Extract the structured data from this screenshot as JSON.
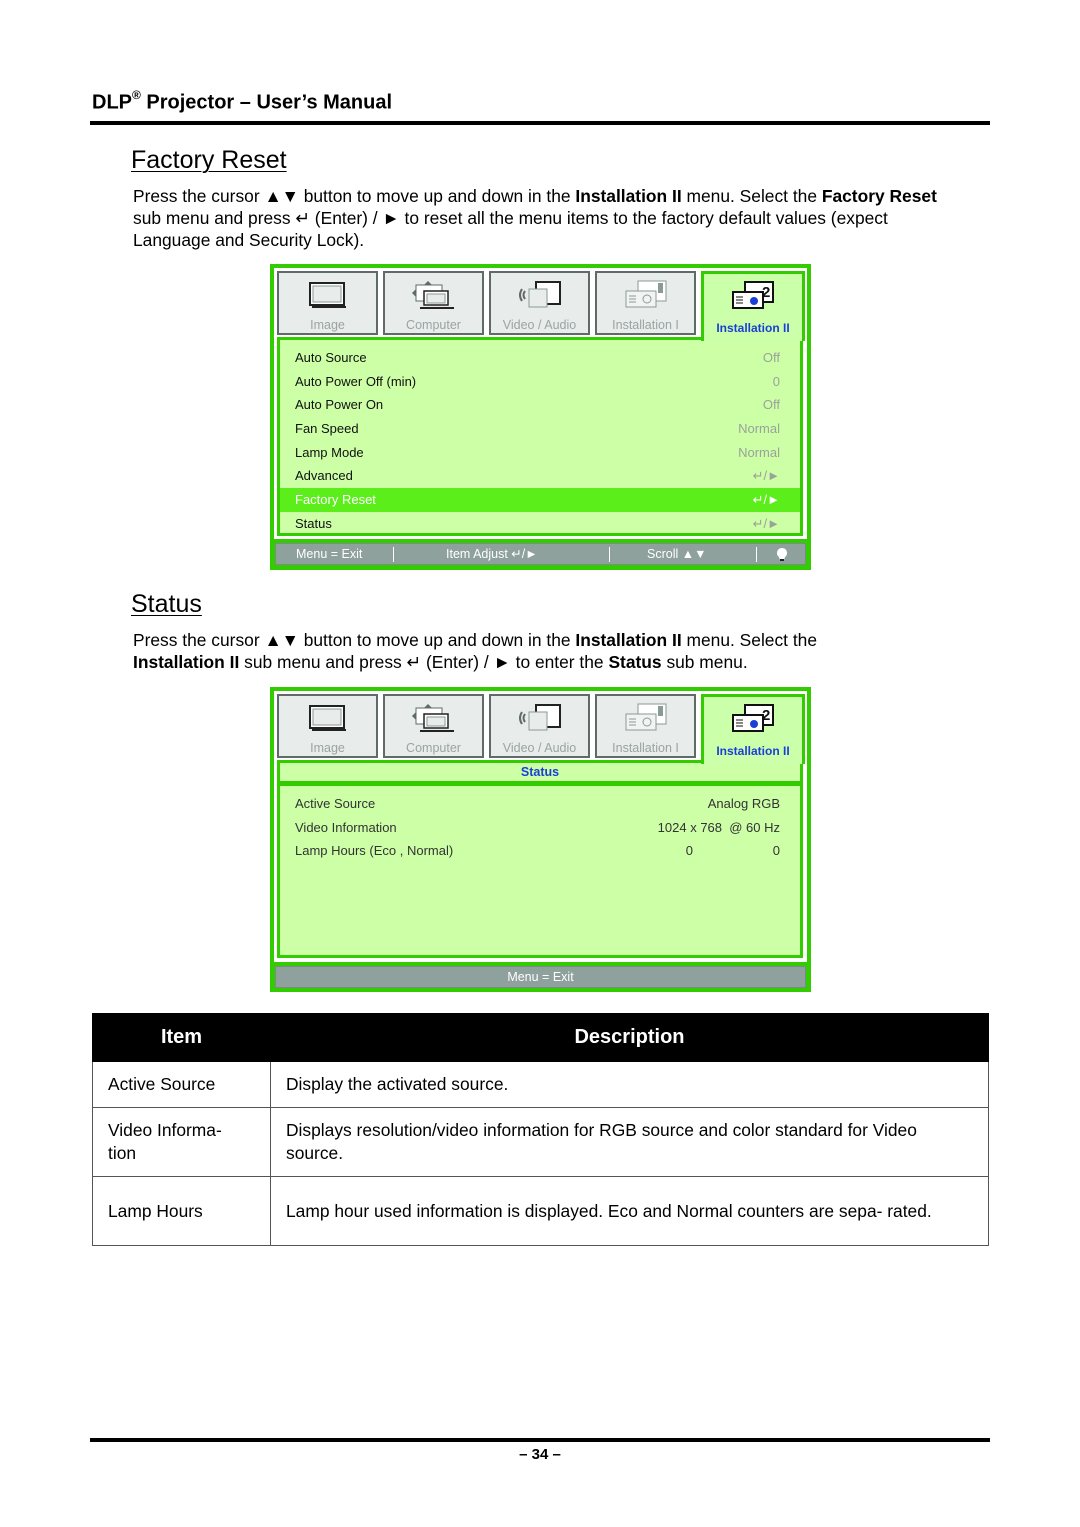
{
  "header": {
    "title_prefix": "DLP",
    "registered_mark": "®",
    "title_suffix": " Projector – User’s Manual"
  },
  "sections": {
    "factory_reset": {
      "title": "Factory Reset",
      "paragraph": {
        "t1": "Press the cursor ▲▼ button to move up and down in the ",
        "b1": "Installation II",
        "t2": " menu. Select the ",
        "b2": "Factory Reset",
        "t3": " sub menu and press ↵ (Enter) / ► to reset all the menu items to the factory default values (expect Language and Security Lock)."
      }
    },
    "status": {
      "title": "Status",
      "paragraph": {
        "t1": "Press the cursor ▲▼ button to move up and down in the ",
        "b1": "Installation II",
        "t2": " menu. Select the ",
        "b2": "Installation II",
        "t3": " sub menu and press ↵ (Enter) / ► to enter the ",
        "b3": "Status",
        "t4": " sub menu."
      }
    }
  },
  "osd_tabs": [
    {
      "label": "Image",
      "icon": "image-icon"
    },
    {
      "label": "Computer",
      "icon": "computer-icon"
    },
    {
      "label": "Video / Audio",
      "icon": "video-audio-icon"
    },
    {
      "label": "Installation I",
      "icon": "installation-1-icon"
    },
    {
      "label": "Installation II",
      "icon": "installation-2-icon",
      "active": true
    }
  ],
  "osd_factory": {
    "rows": [
      {
        "label": "Auto Source",
        "value": "Off"
      },
      {
        "label": "Auto Power Off (min)",
        "value": "0"
      },
      {
        "label": "Auto Power On",
        "value": "Off"
      },
      {
        "label": "Fan Speed",
        "value": "Normal"
      },
      {
        "label": "Lamp Mode",
        "value": "Normal"
      },
      {
        "label": "Advanced",
        "value": "↵/►"
      },
      {
        "label": "Factory Reset",
        "value": "↵/►",
        "selected": true
      },
      {
        "label": "Status",
        "value": "↵/►"
      }
    ],
    "footer": {
      "menu_exit": "Menu = Exit",
      "item_adjust": "Item Adjust ↵/►",
      "scroll": "Scroll ▲▼",
      "lamp_icon": "lamp-icon"
    }
  },
  "osd_status": {
    "title": "Status",
    "rows": [
      {
        "label": "Active Source",
        "value": "Analog RGB"
      },
      {
        "label": "Video Information",
        "value": "1024 x 768  @ 60 Hz"
      },
      {
        "label": "Lamp Hours (Eco , Normal)",
        "value_eco": "0",
        "value_normal": "0"
      }
    ],
    "footer": {
      "menu_exit": "Menu = Exit"
    }
  },
  "table": {
    "headers": [
      "Item",
      "Description"
    ],
    "rows": [
      {
        "item": "Active Source",
        "description": "Display the activated source."
      },
      {
        "item": "Video Informa- tion",
        "description": "Displays resolution/video information for RGB source and color standard for Video source."
      },
      {
        "item": "Lamp Hours",
        "description": "Lamp hour used information is displayed. Eco and Normal counters are sepa- rated."
      }
    ]
  },
  "page_number": "– 34 –",
  "colors": {
    "osd_border": "#33cc00",
    "osd_panel": "#ccffa6",
    "osd_selected": "#5bee1a",
    "active_tab_text": "#1a3fd6",
    "footer_bar": "#8fa19c"
  }
}
